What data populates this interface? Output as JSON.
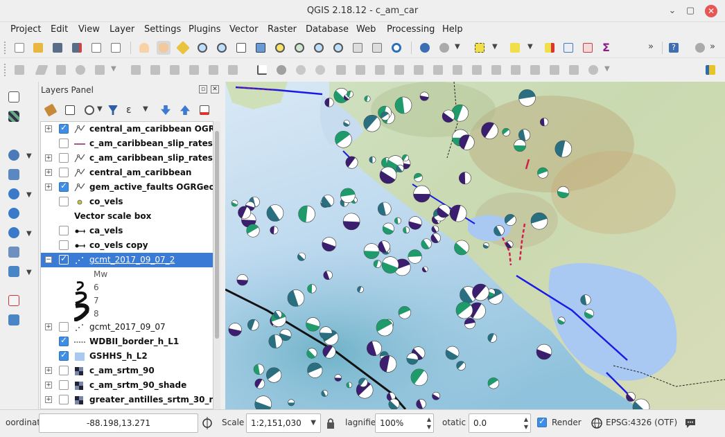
{
  "window": {
    "title": "QGIS 2.18.12 - c_am_car",
    "minimize": "⌄",
    "maximize": "▢",
    "close": "✕"
  },
  "menu": [
    "Project",
    "Edit",
    "View",
    "Layer",
    "Settings",
    "Plugins",
    "Vector",
    "Raster",
    "Database",
    "Web",
    "Processing",
    "Help"
  ],
  "toolbar": {
    "overflow": "»",
    "help_icon": "help-icon"
  },
  "layers_panel": {
    "title": "Layers Panel",
    "float_button": "▫",
    "close_button": "✕",
    "layers": [
      {
        "name": "central_am_caribbean OGR...",
        "checked": true,
        "expandable": true,
        "expanded": false,
        "symbol": "vector-icon"
      },
      {
        "name": "c_am_caribbean_slip_rates ...",
        "checked": false,
        "expandable": false,
        "symbol": "line-icon"
      },
      {
        "name": "c_am_caribbean_slip_rates_...",
        "checked": false,
        "expandable": true,
        "expanded": false,
        "symbol": "vector-icon"
      },
      {
        "name": "central_am_caribbean",
        "checked": false,
        "expandable": true,
        "expanded": false,
        "symbol": "vector-icon"
      },
      {
        "name": "gem_active_faults OGRGeo...",
        "checked": true,
        "expandable": true,
        "expanded": false,
        "symbol": "vector-icon"
      },
      {
        "name": "co_vels",
        "checked": false,
        "expandable": false,
        "symbol": "point-icon"
      },
      {
        "name": "Vector scale box",
        "checked": null,
        "expandable": false,
        "symbol": "none"
      },
      {
        "name": "ca_vels",
        "checked": false,
        "expandable": false,
        "symbol": "arrow-icon"
      },
      {
        "name": "co_vels copy",
        "checked": false,
        "expandable": false,
        "symbol": "arrow-icon"
      },
      {
        "name": "gcmt_2017_09_07_2",
        "checked": true,
        "expandable": true,
        "expanded": true,
        "selected": true,
        "symbol": "dots-icon"
      }
    ],
    "legend": {
      "heading": "Mw",
      "items": [
        "6",
        "7",
        "8"
      ]
    },
    "layers_after": [
      {
        "name": "gcmt_2017_09_07",
        "checked": false,
        "expandable": true,
        "symbol": "dots-icon"
      },
      {
        "name": "WDBII_border_h_L1",
        "checked": true,
        "expandable": false,
        "symbol": "dash-icon"
      },
      {
        "name": "GSHHS_h_L2",
        "checked": true,
        "expandable": false,
        "symbol": "fill-icon"
      },
      {
        "name": "c_am_srtm_90",
        "checked": false,
        "expandable": true,
        "symbol": "raster-icon"
      },
      {
        "name": "c_am_srtm_90_shade",
        "checked": false,
        "expandable": true,
        "symbol": "raster-icon"
      },
      {
        "name": "greater_antilles_srtm_30_nd",
        "checked": false,
        "expandable": true,
        "symbol": "raster-icon"
      }
    ]
  },
  "statusbar": {
    "coordinate_label": "oordinat",
    "coordinate_value": "-88.198,13.271",
    "scale_label": "Scale",
    "scale_value": "1:2,151,030",
    "magnifier_label": "lagnifie",
    "magnifier_value": "100%",
    "rotation_label": "otatic",
    "rotation_value": "0.0",
    "render_label": "Render",
    "render_checked": true,
    "crs_label": "EPSG:4326 (OTF)"
  },
  "colors": {
    "selection": "#3a7bd5",
    "water": "#9ec3e6",
    "lake": "#a9c8f2",
    "fault": "#1a1ae6",
    "slip": "#d0204a",
    "beachball_purple": "#3b1f6e",
    "beachball_teal": "#2a6f80",
    "beachball_green": "#1f9a6a"
  }
}
